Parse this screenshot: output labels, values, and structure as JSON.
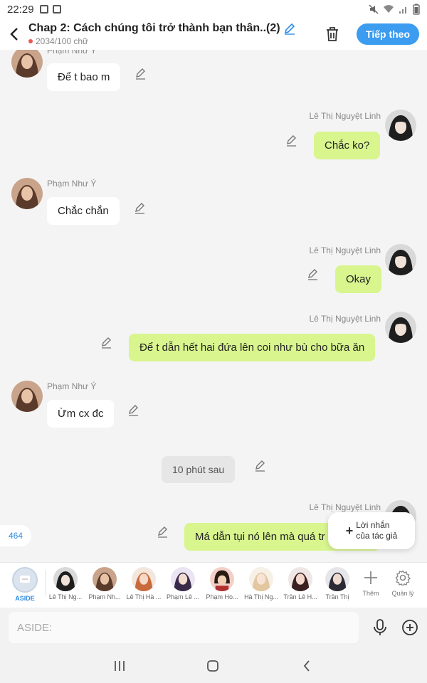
{
  "status_bar": {
    "time": "22:29"
  },
  "header": {
    "title": "Chap 2: Cách chúng tôi trở thành bạn thân..(2)",
    "word_count": "2034/100 chữ",
    "follow_label": "Tiếp theo"
  },
  "messages": [
    {
      "side": "left",
      "name": "Phạm Như Ý",
      "text": "Để t bao m"
    },
    {
      "side": "right",
      "name": "Lê Thị Nguyệt Linh",
      "text": "Chắc ko?"
    },
    {
      "side": "left",
      "name": "Phạm Như Ý",
      "text": "Chắc chắn"
    },
    {
      "side": "right",
      "name": "Lê Thị Nguyệt Linh",
      "text": "Okay"
    },
    {
      "side": "right",
      "name": "Lê Thị Nguyệt Linh",
      "text": "Để t dẫn hết hai đứa lên coi như bù cho bữa ăn"
    },
    {
      "side": "left",
      "name": "Phạm Như Ý",
      "text": "Ừm cx đc"
    },
    {
      "side": "center",
      "text": "10 phút sau"
    },
    {
      "side": "right",
      "name": "Lê Thị Nguyệt Linh",
      "text": "Má dẫn tụi nó lên mà quá tr"
    }
  ],
  "count_badge": "464",
  "author_note": {
    "line1": "Lời nhắn",
    "line2": "của tác giả"
  },
  "characters": {
    "aside_label": "ASIDE",
    "items": [
      {
        "label": "Lê Thị Ng..."
      },
      {
        "label": "Phạm Nh..."
      },
      {
        "label": "Lê Thị Hà ..."
      },
      {
        "label": "Phạm Lê ..."
      },
      {
        "label": "Phạm Ho..."
      },
      {
        "label": "Hà Thị Ng..."
      },
      {
        "label": "Trần Lê H..."
      },
      {
        "label": "Trần Thị"
      }
    ],
    "more_label": "Thêm",
    "manage_label": "Quản lý"
  },
  "input": {
    "placeholder": "ASIDE:"
  },
  "colors": {
    "accent": "#3b9cf0",
    "green_bubble": "#d8f58e",
    "white_bubble": "#ffffff"
  }
}
